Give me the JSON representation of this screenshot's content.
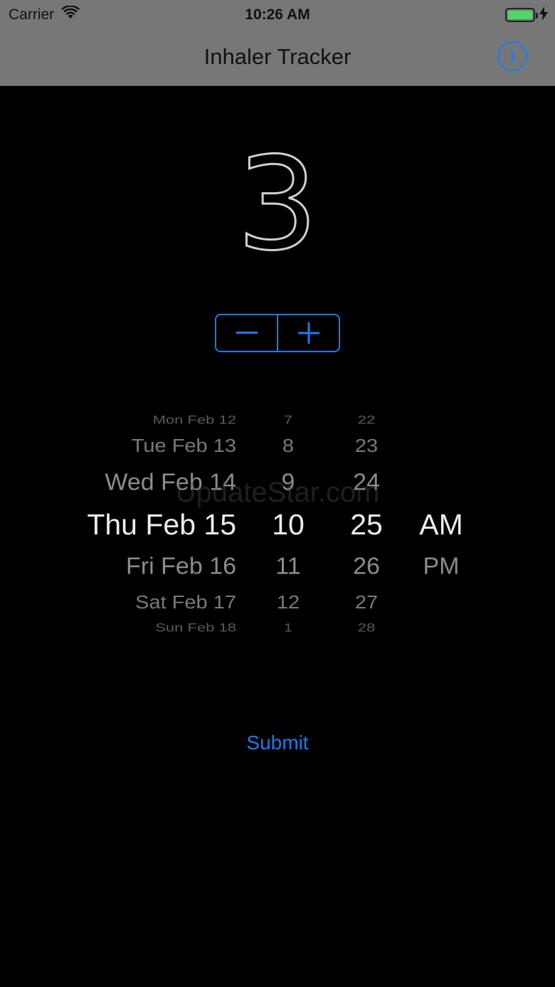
{
  "status_bar": {
    "carrier": "Carrier",
    "time": "10:26 AM"
  },
  "nav": {
    "title": "Inhaler Tracker",
    "info_icon": "info-circle-icon"
  },
  "counter": {
    "value": "3"
  },
  "stepper": {
    "minus_icon": "minus-icon",
    "plus_icon": "plus-icon"
  },
  "date_picker": {
    "dates": [
      "Mon Feb 12",
      "Tue Feb 13",
      "Wed Feb 14",
      "Thu Feb 15",
      "Fri Feb 16",
      "Sat Feb 17",
      "Sun Feb 18"
    ],
    "hours": [
      "7",
      "8",
      "9",
      "10",
      "11",
      "12",
      "1"
    ],
    "minutes": [
      "22",
      "23",
      "24",
      "25",
      "26",
      "27",
      "28"
    ],
    "periods": [
      "AM",
      "PM"
    ],
    "selected": {
      "date": "Thu Feb 15",
      "hour": "10",
      "minute": "25",
      "period": "AM"
    }
  },
  "watermark": "UpdateStar.com",
  "submit_label": "Submit",
  "colors": {
    "accent": "#1a7cf2",
    "nav_bar": "#777777",
    "background": "#000000",
    "battery": "#4cd964"
  }
}
